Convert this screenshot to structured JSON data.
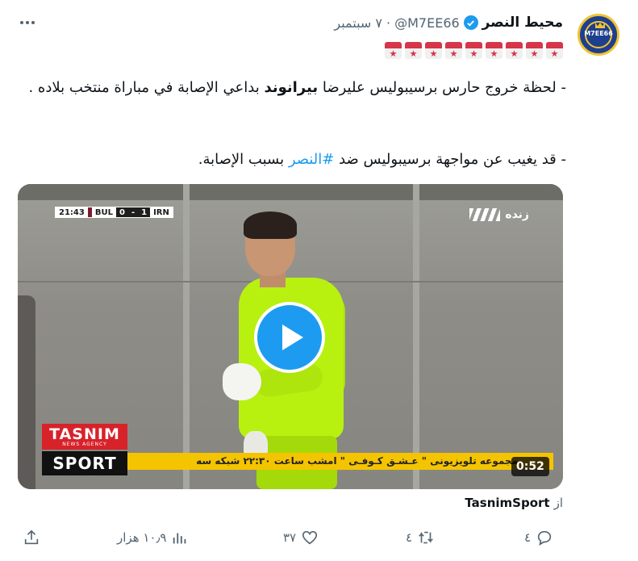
{
  "author": {
    "name": "محيط النصر",
    "handle": "@M7EE66",
    "separator": "·",
    "date": "٧ سبتمبر",
    "avatar_text": "M7EE66",
    "verified": true
  },
  "emoji_row": {
    "count": 9,
    "icon": "calendar-star-emoji"
  },
  "text": {
    "p1_a": "- لحظة خروج حارس برسيبوليس عليرضا ",
    "p1_bold": "بيرانوند",
    "p1_b": " بداعي الإصابة في مباراة منتخب بلاده .",
    "p2_a": "- قد يغيب عن مواجهة برسيبوليس ضد ",
    "p2_hashtag": "#النصر",
    "p2_b": " بسبب الإصابة."
  },
  "video": {
    "score": {
      "time": "21:43",
      "team1": "BUL",
      "score1": "0",
      "sep": "-",
      "score2": "1",
      "team2": "IRN"
    },
    "live_label": "زنده",
    "ticker": "مجموعه تلويزيونى \" عـشـق كـوفـى \"   امشب ساعت ٢٢:٣٠   شبكه سه",
    "brand_top": "TASNIM",
    "brand_small": "NEWS AGENCY",
    "brand_bottom": "SPORT",
    "duration": "0:52",
    "colors": {
      "play": "#1d9bf0",
      "ticker": "#f5c400",
      "tasnim_red": "#d8222a",
      "kit": "#b8f010"
    }
  },
  "source": {
    "label": "از",
    "name": "TasnimSport"
  },
  "actions": {
    "reply": "٤",
    "retweet": "٤",
    "like": "٣٧",
    "views": "١٠٫٩ هزار"
  },
  "colors": {
    "accent": "#1d9bf0",
    "text": "#0f1419",
    "muted": "#536471"
  }
}
